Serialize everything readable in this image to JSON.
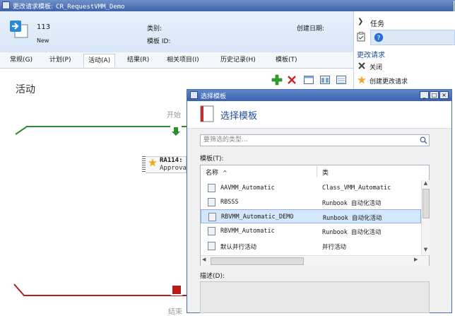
{
  "main_window": {
    "title": "更改请求模板:",
    "title_suffix": "CR_RequestVMM_Demo",
    "id_value": "113",
    "status_value": "New",
    "category_label": "类别:",
    "template_id_label": "模板 ID:",
    "created_date_label": "创建日期:",
    "tabs": [
      {
        "label": "常规(G)"
      },
      {
        "label": "计划(P)"
      },
      {
        "label": "活动(A)"
      },
      {
        "label": "结果(R)"
      },
      {
        "label": "相关项目(I)"
      },
      {
        "label": "历史记录(H)"
      },
      {
        "label": "模板(T)"
      }
    ],
    "active_tab": "活动(A)",
    "activities_title": "活动",
    "workflow": {
      "start_label": "开始",
      "end_label": "结束",
      "activity_id": "RA114:",
      "activity_name": "Approva"
    }
  },
  "task_pane": {
    "header": "任务",
    "section_title": "更改请求",
    "items": [
      {
        "label": "关闭",
        "icon": "close-x-icon"
      },
      {
        "label": "创建更改请求",
        "icon": "star-burst-icon"
      }
    ]
  },
  "dialog": {
    "title": "选择模板",
    "heading": "选择模板",
    "search_placeholder": "要筛选的类型...",
    "templates_label": "模板(T):",
    "columns": {
      "name": "名称",
      "type": "类"
    },
    "rows": [
      {
        "name": "AAVMM_Automatic",
        "type": "Class_VMM_Automatic",
        "selected": false
      },
      {
        "name": "RBSSS",
        "type": "Runbook 自动化活动",
        "selected": false
      },
      {
        "name": "RBVMM_Automatic_DEMO",
        "type": "Runbook 自动化活动",
        "selected": true
      },
      {
        "name": "RBVMM_Automatic",
        "type": "Runbook 自动化活动",
        "selected": false
      },
      {
        "name": "默认并行活动",
        "type": "并行活动",
        "selected": false
      }
    ],
    "description_label": "描述(D):",
    "window_controls": {
      "minimize": "_",
      "maximize": "□",
      "close": "×"
    }
  },
  "colors": {
    "titlebar": "#3d64ab",
    "header_bg": "#e1edf9",
    "selection": "#d4e6fb",
    "start_line": "#2f8a2f",
    "end_line": "#b02020",
    "add_green": "#2e9e2e",
    "delete_red": "#cc2222"
  }
}
